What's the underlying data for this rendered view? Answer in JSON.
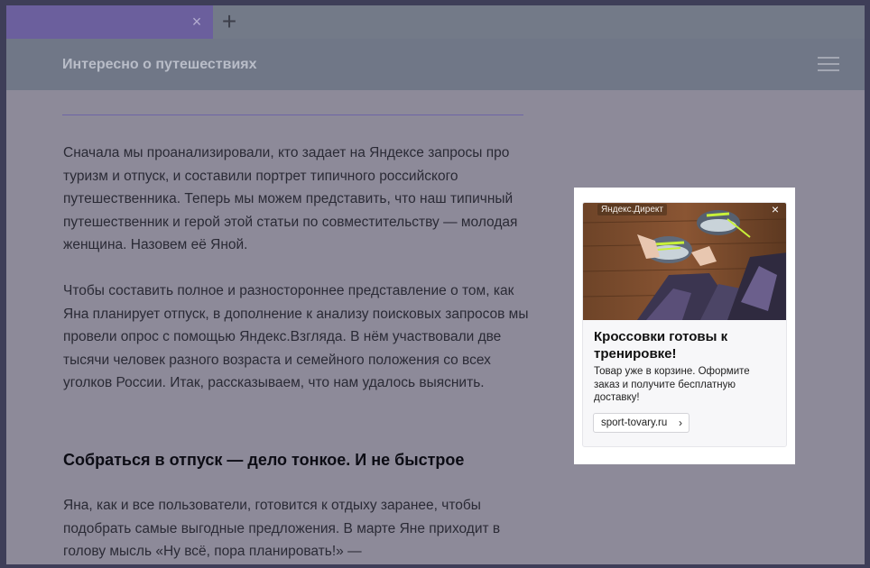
{
  "browser": {
    "tab_close": "×",
    "new_tab": "+"
  },
  "site": {
    "title": "Интересно о путешествиях"
  },
  "article": {
    "paragraph1": "Сначала мы проанализировали, кто задает на Яндексе запросы про туризм и отпуск, и составили портрет типичного российского путешественника. Теперь мы можем представить, что наш типичный путешественник и герой этой статьи по совместительству — молодая женщина. Назовем её Яной.",
    "paragraph2": "Чтобы составить полное и разностороннее представление о том, как Яна планирует отпуск, в дополнение к анализу поисковых запросов мы провели опрос с помощью Яндекс.Взгляда. В нём участвовали две тысячи человек разного возраста и семейного положения со всех уголков России. Итак, рассказываем, что нам удалось выяснить.",
    "heading": "Собраться в отпуск — дело тонкое. И не быстрое",
    "paragraph3": "Яна, как и все пользователи, готовится к отдыху заранее, чтобы подобрать самые выгодные предложения. В марте Яне приходит в голову мысль «Ну всё, пора планировать!» —"
  },
  "ad": {
    "label": "Яндекс.Директ",
    "close": "×",
    "title": "Кроссовки готовы к тренировке!",
    "text": "Товар уже в корзине. Оформите заказ и получите бесплатную доставку!",
    "link": "sport-tovary.ru",
    "link_chevron": "›",
    "image_icon": "sneakers-photo"
  },
  "colors": {
    "overlay": "#8d8a99",
    "active_tab": "#6b5f9d",
    "header": "#707787",
    "divider": "#6d64a6"
  }
}
